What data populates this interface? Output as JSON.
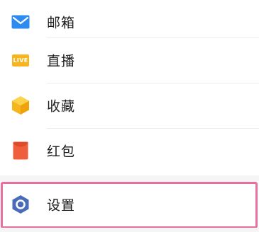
{
  "menu": {
    "items": [
      {
        "label": "邮箱",
        "icon": "mail-icon",
        "color": "#2e8cf0"
      },
      {
        "label": "直播",
        "icon": "live-icon",
        "color": "#f7b51d",
        "badge_text": "LIVE"
      },
      {
        "label": "收藏",
        "icon": "favorites-cube-icon",
        "color": "#f7b51d"
      },
      {
        "label": "红包",
        "icon": "red-envelope-icon",
        "color": "#f05f3c"
      }
    ],
    "settings": {
      "label": "设置",
      "icon": "settings-hexagon-icon",
      "color": "#4a6bb8"
    },
    "highlight_color": "#e86f9e"
  }
}
